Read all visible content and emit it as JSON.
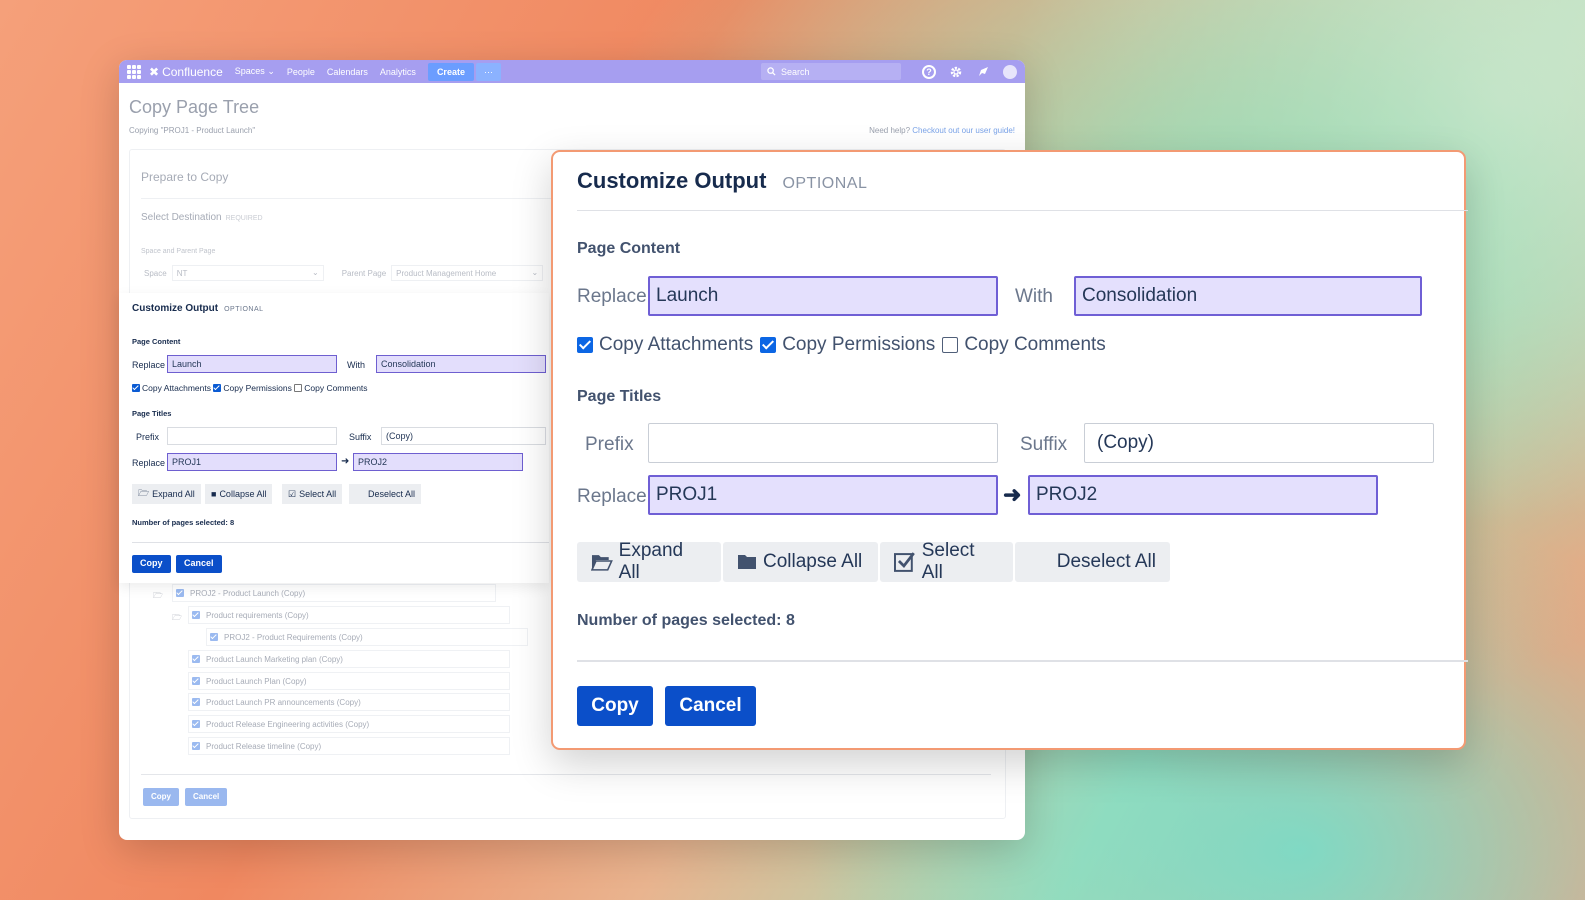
{
  "navbar": {
    "logo": "Confluence",
    "items": [
      "Spaces",
      "People",
      "Calendars",
      "Analytics"
    ],
    "create_label": "Create",
    "more_label": "···",
    "search_placeholder": "Search",
    "help_icon_label": "?"
  },
  "page": {
    "title": "Copy Page Tree",
    "subtitle": "Copying \"PROJ1 - Product Launch\"",
    "help_text": "Need help?",
    "help_link": "Checkout out our user guide!"
  },
  "prepare": {
    "heading": "Prepare to Copy",
    "select_destination": "Select Destination",
    "required": "REQUIRED",
    "space_parent_label": "Space and Parent Page",
    "space_label": "Space",
    "space_value": "NT",
    "parent_label": "Parent Page",
    "parent_value": "Product Management Home"
  },
  "tree": [
    "PROJ2 - Product Launch (Copy)",
    "Product requirements (Copy)",
    "PROJ2 - Product Requirements (Copy)",
    "Product Launch Marketing plan (Copy)",
    "Product Launch Plan (Copy)",
    "Product Launch PR announcements (Copy)",
    "Product Release Engineering activities (Copy)",
    "Product Release timeline (Copy)"
  ],
  "customize": {
    "title": "Customize Output",
    "optional": "OPTIONAL",
    "page_content_heading": "Page Content",
    "replace_label": "Replace",
    "replace_value": "Launch",
    "with_label": "With",
    "with_value": "Consolidation",
    "copy_attachments": "Copy Attachments",
    "copy_permissions": "Copy Permissions",
    "copy_comments": "Copy Comments",
    "page_titles_heading": "Page Titles",
    "prefix_label": "Prefix",
    "prefix_value": "",
    "suffix_label": "Suffix",
    "suffix_value": "(Copy)",
    "title_replace_label": "Replace",
    "title_replace_value": "PROJ1",
    "arrow": "➜",
    "title_with_value": "PROJ2",
    "expand_all": "Expand All",
    "collapse_all": "Collapse All",
    "select_all": "Select All",
    "deselect_all": "Deselect All",
    "pages_selected": "Number of pages selected: 8",
    "copy_button": "Copy",
    "cancel_button": "Cancel"
  },
  "colors": {
    "accent": "#0b4fc9",
    "input_highlight": "#e4e0fd",
    "input_border": "#6f5fd5",
    "navbar": "#a69ef0",
    "dialog_border": "#f39a73"
  }
}
